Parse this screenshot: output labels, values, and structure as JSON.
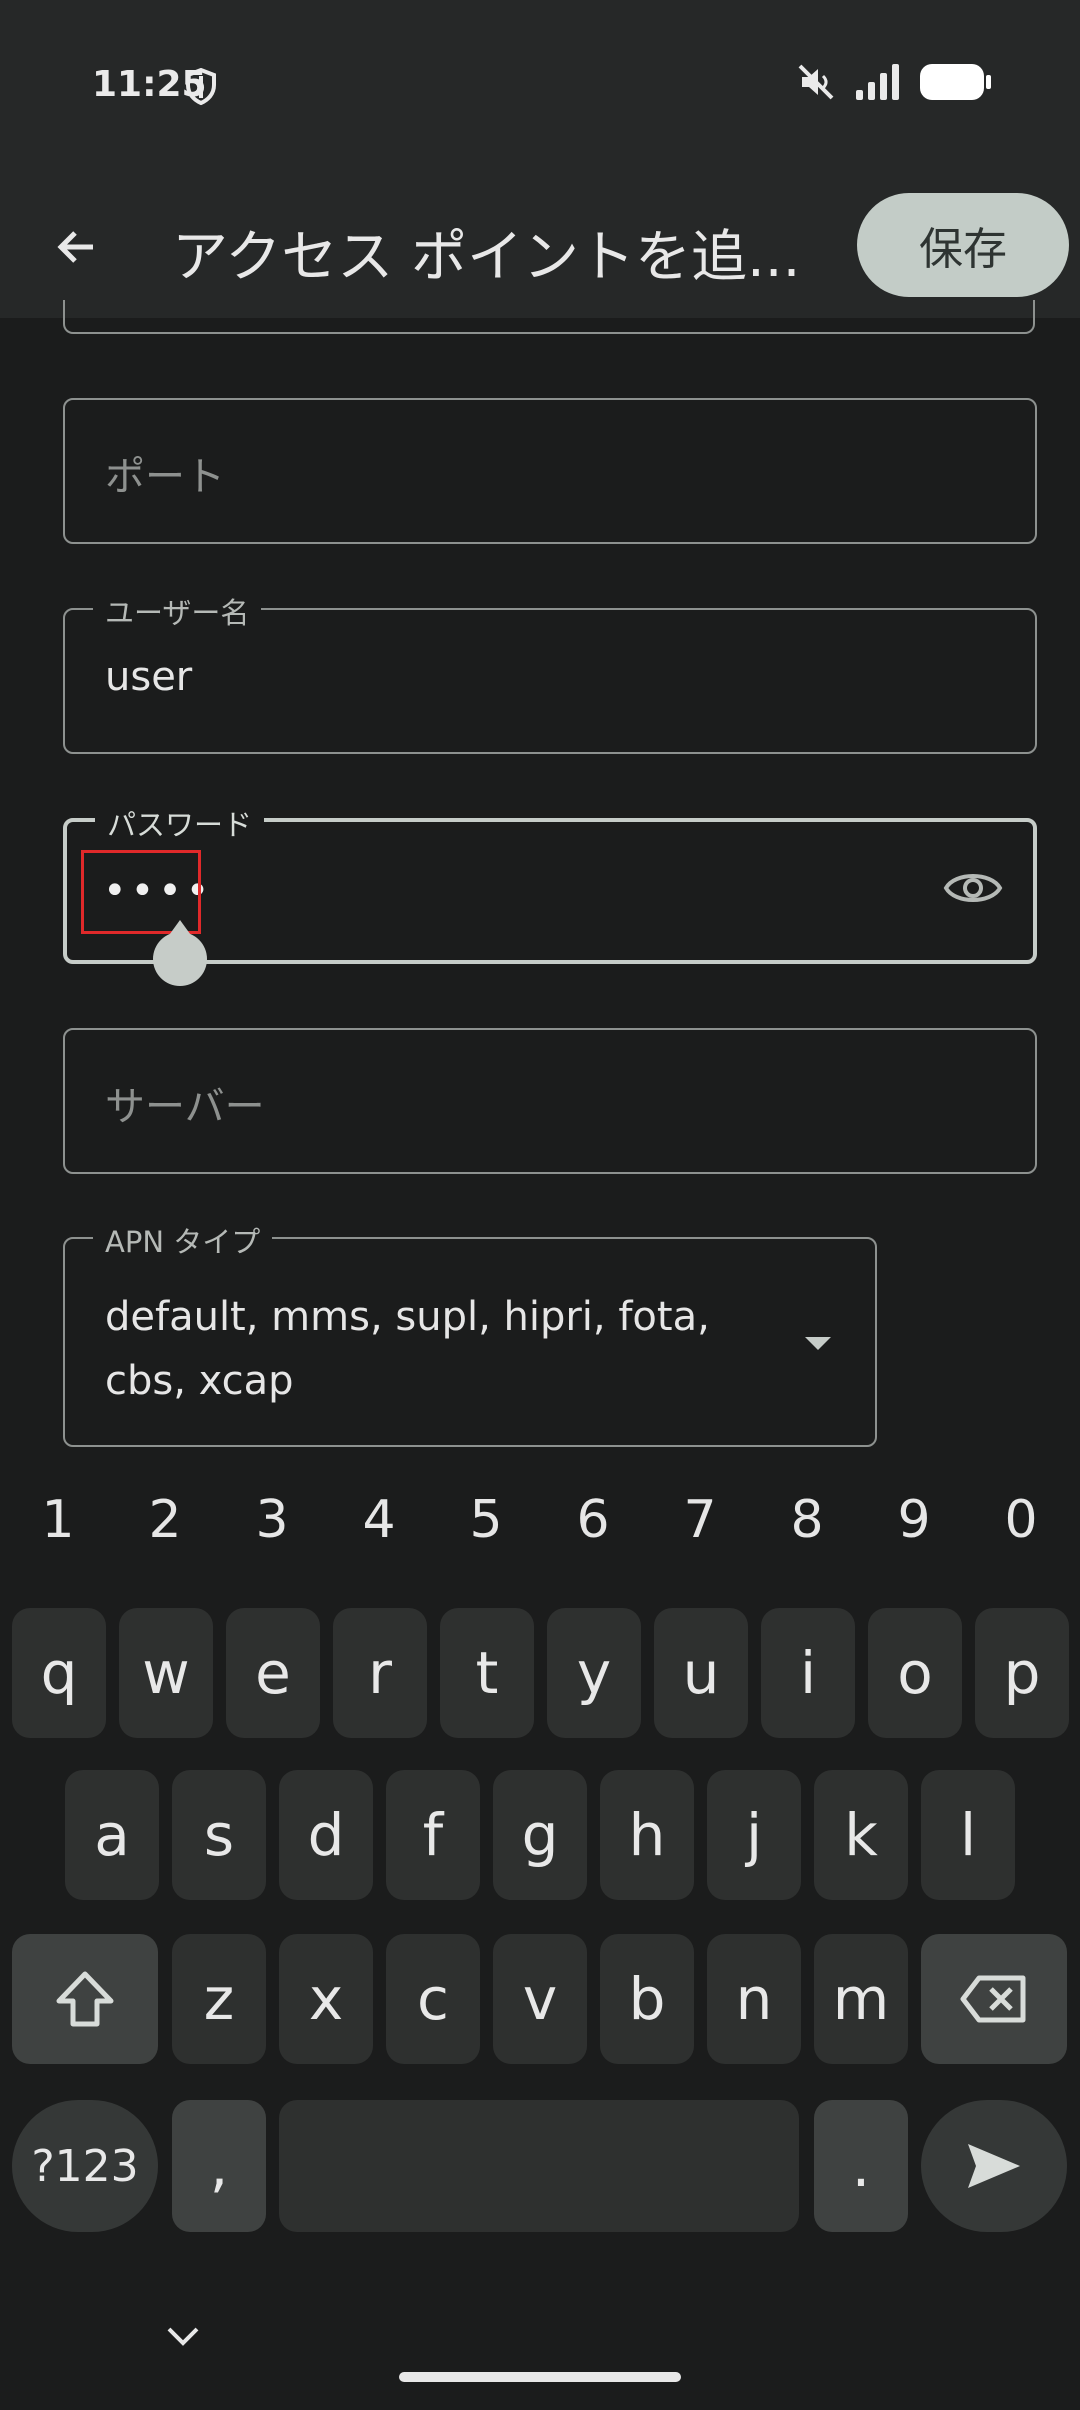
{
  "status": {
    "time": "11:25"
  },
  "appbar": {
    "title": "アクセス ポイントを追...",
    "save_label": "保存"
  },
  "fields": {
    "port": {
      "placeholder": "ポート"
    },
    "username": {
      "label": "ユーザー名",
      "value": "user"
    },
    "password": {
      "label": "パスワード",
      "value": "••••"
    },
    "server": {
      "placeholder": "サーバー"
    },
    "apn_type": {
      "label": "APN タイプ",
      "line1": "default, mms, supl, hipri, fota,",
      "line2": "cbs, xcap"
    }
  },
  "keyboard": {
    "numbers": [
      "1",
      "2",
      "3",
      "4",
      "5",
      "6",
      "7",
      "8",
      "9",
      "0"
    ],
    "row1": [
      "q",
      "w",
      "e",
      "r",
      "t",
      "y",
      "u",
      "i",
      "o",
      "p"
    ],
    "row2": [
      "a",
      "s",
      "d",
      "f",
      "g",
      "h",
      "j",
      "k",
      "l"
    ],
    "row3": [
      "z",
      "x",
      "c",
      "v",
      "b",
      "n",
      "m"
    ],
    "symbols_label": "?123",
    "comma": ",",
    "period": "."
  },
  "icons": {
    "back": "arrow-left-icon",
    "visibility": "eye-icon",
    "shift": "shift-icon",
    "backspace": "backspace-icon",
    "send": "send-icon"
  }
}
